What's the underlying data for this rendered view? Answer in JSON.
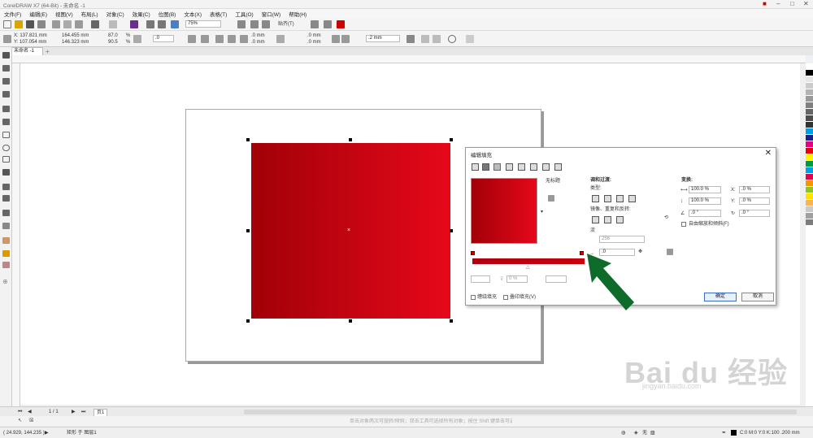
{
  "app": {
    "title": "CorelDRAW X7 (64-Bit) - 未命名 -1"
  },
  "menu": [
    "文件(F)",
    "编辑(E)",
    "视图(V)",
    "布局(L)",
    "对象(C)",
    "效果(C)",
    "位图(B)",
    "文本(X)",
    "表格(T)",
    "工具(O)",
    "窗口(W)",
    "帮助(H)"
  ],
  "toolbar": {
    "zoom": "75%",
    "snap": "贴齐(T)"
  },
  "props": {
    "x": "X: 137.821 mm",
    "y": "Y: 107.054 mm",
    "w": "164.455 mm",
    "h": "146.323 mm",
    "sx": "87.0",
    "sy": "90.5",
    "pct": "%",
    "rot": ".0",
    "c1": ".0 mm",
    "c2": ".0 mm",
    "c3": ".0 mm",
    "c4": ".0 mm",
    "outline": ".2 mm"
  },
  "doc_tab": "未命名 -1",
  "dialog": {
    "title": "编辑填充",
    "untitled": "无标题",
    "blend_title": "调和过渡:",
    "type_label": "类型:",
    "mirror_label": "镜像、重复和反转:",
    "step_label": "流",
    "steps": "256",
    "transform_title": "变换:",
    "scale_w": "100.0 %",
    "scale_h": "100.0 %",
    "offset_x": ".0 %",
    "offset_y": ".0 %",
    "rotate": ".0 °",
    "skew": ".0 °",
    "free_scale": "自由缩放和倾斜(F)",
    "node_pos": ".0",
    "pct_val": "0 %",
    "wrap_fill": "缠绕填充",
    "overprint": "叠印填充(V)",
    "ok": "确定",
    "cancel": "取消"
  },
  "status": {
    "coords": "( 24.929, 144.235 )",
    "object": "矩形 于 图层1",
    "hint": "单击对象两次可旋转/倾斜；双击工具可选择所有对象；按住 Shift 键单击可选择多个对象；按住 Alt 键单击可进行挖掘；以及…",
    "fill_none": "无",
    "color_info": "C:0 M:0 Y:0 K:100 .200 mm",
    "page_nav": "1 / 1",
    "page_tab": "页1"
  },
  "watermark": {
    "brand": "Bai du 经验",
    "url": "jingyan.baidu.com"
  },
  "palette_colors": [
    "#ffffff",
    "#000000",
    "#e6e6e6",
    "#cccccc",
    "#b3b3b3",
    "#999999",
    "#808080",
    "#666666",
    "#4d4d4d",
    "#333333",
    "#00a0e9",
    "#1d2088",
    "#e4007f",
    "#e60012",
    "#fff100",
    "#009944",
    "#00a0e9",
    "#e5004f",
    "#f39800",
    "#8fc31f",
    "#ffe100",
    "#f8b551",
    "#c9caca",
    "#a0a0a0",
    "#7d7d7d"
  ]
}
